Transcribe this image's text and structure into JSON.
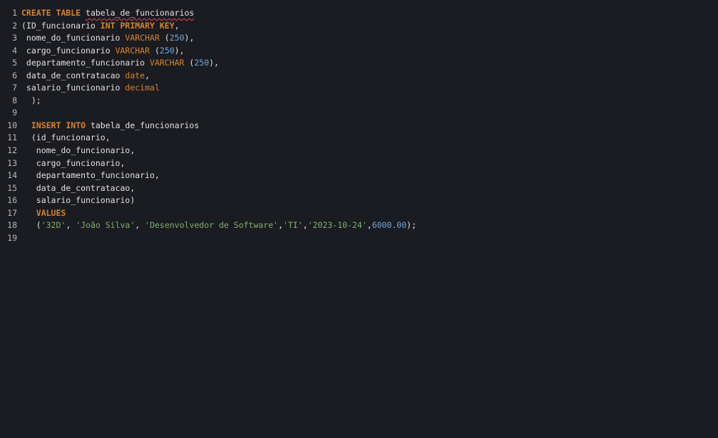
{
  "lines": [
    {
      "num": "1",
      "segs": [
        {
          "t": "CREATE TABLE",
          "c": "kw"
        },
        {
          "t": " ",
          "c": "plain"
        },
        {
          "t": "tabela_de_funcionarios",
          "c": "plain squiggle"
        }
      ]
    },
    {
      "num": "2",
      "segs": [
        {
          "t": "(ID_funcionario ",
          "c": "plain"
        },
        {
          "t": "INT PRIMARY KEY",
          "c": "kw"
        },
        {
          "t": ",",
          "c": "plain"
        }
      ]
    },
    {
      "num": "3",
      "segs": [
        {
          "t": " nome_do_funcionario ",
          "c": "plain"
        },
        {
          "t": "VARCHAR",
          "c": "type"
        },
        {
          "t": " (",
          "c": "plain"
        },
        {
          "t": "250",
          "c": "num"
        },
        {
          "t": "),",
          "c": "plain"
        }
      ]
    },
    {
      "num": "4",
      "segs": [
        {
          "t": " cargo_funcionario ",
          "c": "plain"
        },
        {
          "t": "VARCHAR",
          "c": "type"
        },
        {
          "t": " (",
          "c": "plain"
        },
        {
          "t": "250",
          "c": "num"
        },
        {
          "t": "),",
          "c": "plain"
        }
      ]
    },
    {
      "num": "5",
      "segs": [
        {
          "t": " departamento_funcionario ",
          "c": "plain"
        },
        {
          "t": "VARCHAR",
          "c": "type"
        },
        {
          "t": " (",
          "c": "plain"
        },
        {
          "t": "250",
          "c": "num"
        },
        {
          "t": "),",
          "c": "plain"
        }
      ]
    },
    {
      "num": "6",
      "segs": [
        {
          "t": " data_de_contratacao ",
          "c": "plain"
        },
        {
          "t": "date",
          "c": "type"
        },
        {
          "t": ",",
          "c": "plain"
        }
      ]
    },
    {
      "num": "7",
      "segs": [
        {
          "t": " salario_funcionario ",
          "c": "plain"
        },
        {
          "t": "decimal",
          "c": "type"
        }
      ]
    },
    {
      "num": "8",
      "segs": [
        {
          "t": "  );",
          "c": "plain"
        }
      ]
    },
    {
      "num": "9",
      "segs": []
    },
    {
      "num": "10",
      "segs": [
        {
          "t": "  ",
          "c": "plain"
        },
        {
          "t": "INSERT INTO",
          "c": "kw"
        },
        {
          "t": " tabela_de_funcionarios",
          "c": "plain"
        }
      ]
    },
    {
      "num": "11",
      "segs": [
        {
          "t": "  (id_funcionario,",
          "c": "plain"
        }
      ]
    },
    {
      "num": "12",
      "segs": [
        {
          "t": "   nome_do_funcionario,",
          "c": "plain"
        }
      ]
    },
    {
      "num": "13",
      "segs": [
        {
          "t": "   cargo_funcionario,",
          "c": "plain"
        }
      ]
    },
    {
      "num": "14",
      "segs": [
        {
          "t": "   departamento_funcionario,",
          "c": "plain"
        }
      ]
    },
    {
      "num": "15",
      "segs": [
        {
          "t": "   data_de_contratacao,",
          "c": "plain"
        }
      ]
    },
    {
      "num": "16",
      "segs": [
        {
          "t": "   salario_funcionario)",
          "c": "plain"
        }
      ]
    },
    {
      "num": "17",
      "segs": [
        {
          "t": "   ",
          "c": "plain"
        },
        {
          "t": "VALUES",
          "c": "kw"
        }
      ]
    },
    {
      "num": "18",
      "segs": [
        {
          "t": "   (",
          "c": "plain"
        },
        {
          "t": "'32D'",
          "c": "str"
        },
        {
          "t": ", ",
          "c": "plain"
        },
        {
          "t": "'João Silva'",
          "c": "str"
        },
        {
          "t": ", ",
          "c": "plain"
        },
        {
          "t": "'Desenvolvedor de Software'",
          "c": "str"
        },
        {
          "t": ",",
          "c": "plain"
        },
        {
          "t": "'TI'",
          "c": "str"
        },
        {
          "t": ",",
          "c": "plain"
        },
        {
          "t": "'2023-10-24'",
          "c": "str"
        },
        {
          "t": ",",
          "c": "plain"
        },
        {
          "t": "6000.00",
          "c": "num"
        },
        {
          "t": ");",
          "c": "plain"
        }
      ]
    },
    {
      "num": "19",
      "segs": []
    }
  ],
  "colors": {
    "background": "#1b1c21",
    "keyword": "#d9822b",
    "number": "#6fa8dc",
    "string": "#7fb069",
    "text": "#e1e1e1",
    "error_underline": "#e0484a"
  }
}
